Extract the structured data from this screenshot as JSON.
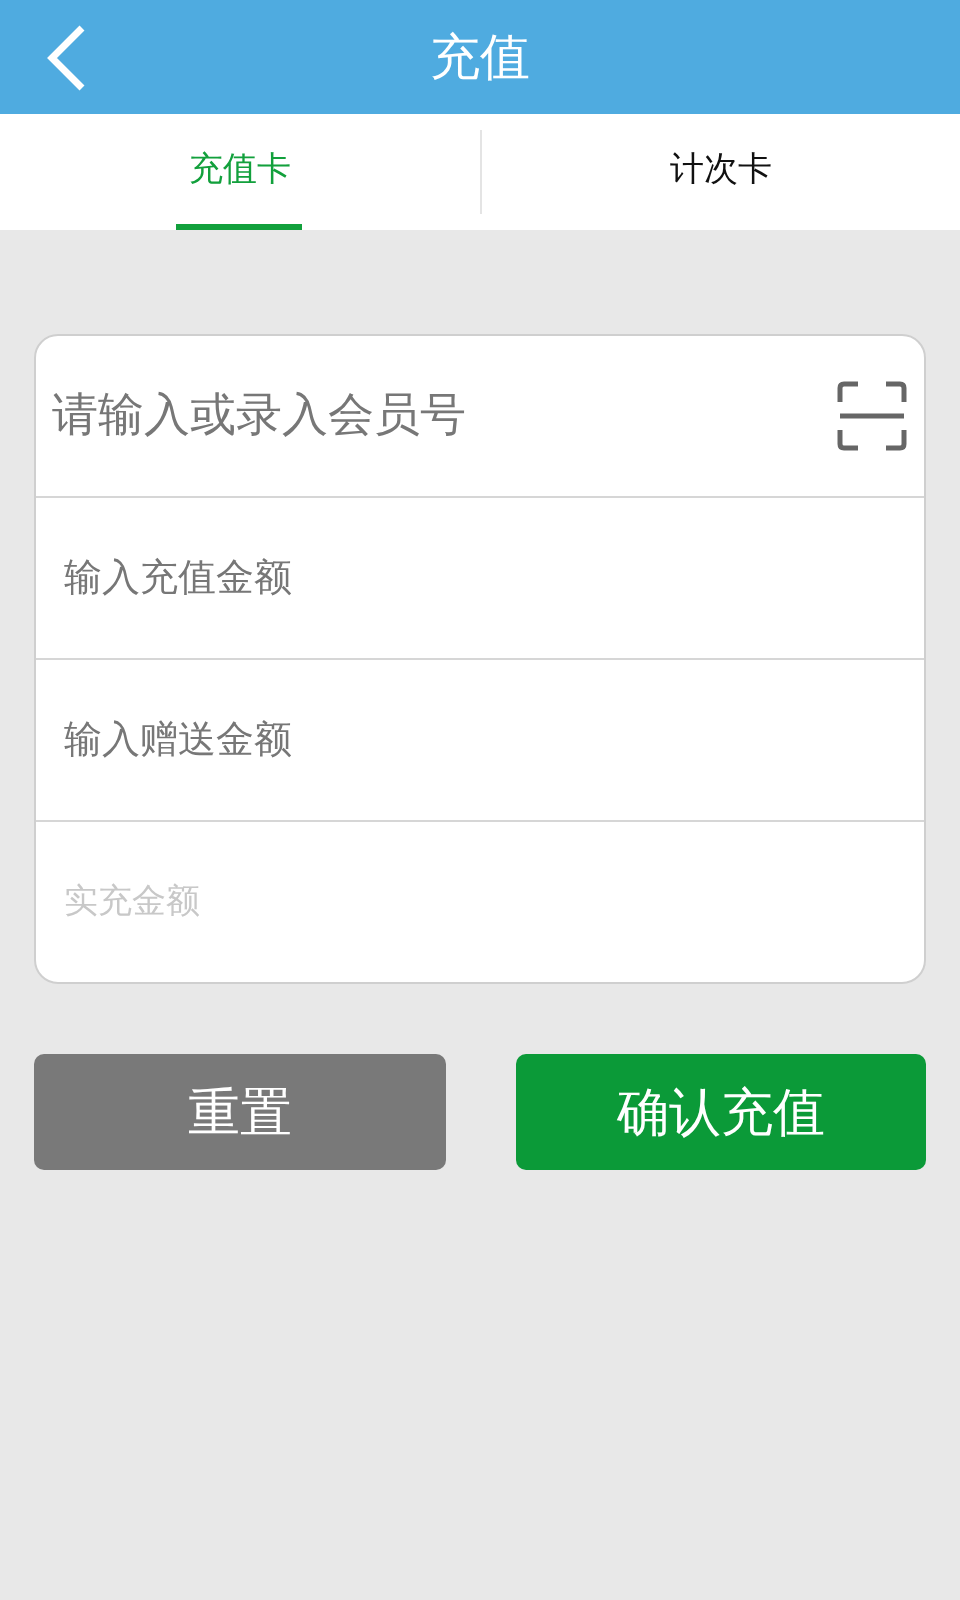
{
  "header": {
    "title": "充值"
  },
  "tabs": [
    {
      "label": "充值卡",
      "selected": true
    },
    {
      "label": "计次卡",
      "selected": false
    }
  ],
  "fields": [
    {
      "kind": "member",
      "placeholder": "请输入或录入会员号",
      "disabled": false
    },
    {
      "kind": "amount",
      "placeholder": "输入充值金额",
      "disabled": false
    },
    {
      "kind": "amount",
      "placeholder": "输入赠送金额",
      "disabled": false
    },
    {
      "kind": "amount",
      "placeholder": "实充金额",
      "disabled": true
    }
  ],
  "buttons": [
    {
      "kind": "reset",
      "label": "重置"
    },
    {
      "kind": "confirm",
      "label": "确认充值"
    }
  ]
}
